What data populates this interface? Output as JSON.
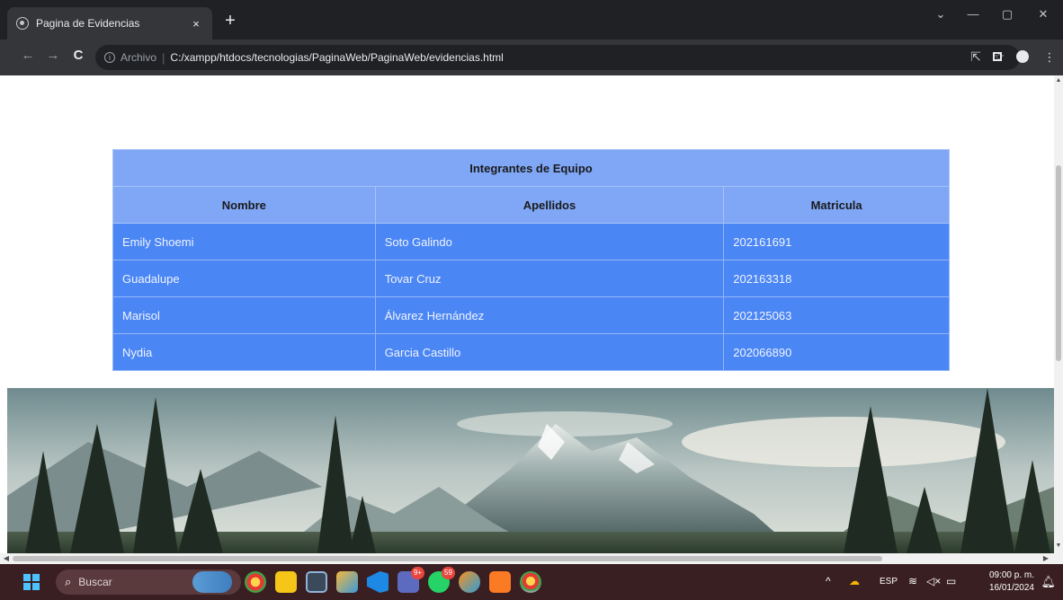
{
  "browser": {
    "tab": {
      "title": "Pagina de Evidencias",
      "close": "×"
    },
    "new_tab": "+",
    "window_controls": {
      "tabsearch": "⌄",
      "minimize": "—",
      "maximize": "▢",
      "close": "✕"
    },
    "toolbar": {
      "back": "←",
      "forward": "→",
      "reload": "C",
      "scheme_label": "Archivo",
      "separator": "|",
      "url": "C:/xampp/htdocs/tecnologias/PaginaWeb/PaginaWeb/evidencias.html"
    }
  },
  "page": {
    "table": {
      "caption": "Integrantes de Equipo",
      "headers": [
        "Nombre",
        "Apellidos",
        "Matricula"
      ],
      "rows": [
        [
          "Emily Shoemi",
          "Soto Galindo",
          "202161691"
        ],
        [
          "Guadalupe",
          "Tovar Cruz",
          "202163318"
        ],
        [
          "Marisol",
          "Álvarez Hernández",
          "202125063"
        ],
        [
          "Nydia",
          "Garcia Castillo",
          "202066890"
        ]
      ]
    }
  },
  "taskbar": {
    "search_placeholder": "Buscar",
    "teams_badge": "9+",
    "whatsapp_badge": "59",
    "tray": {
      "language": "ESP"
    },
    "clock": {
      "time": "09:00 p. m.",
      "date": "16/01/2024"
    }
  }
}
